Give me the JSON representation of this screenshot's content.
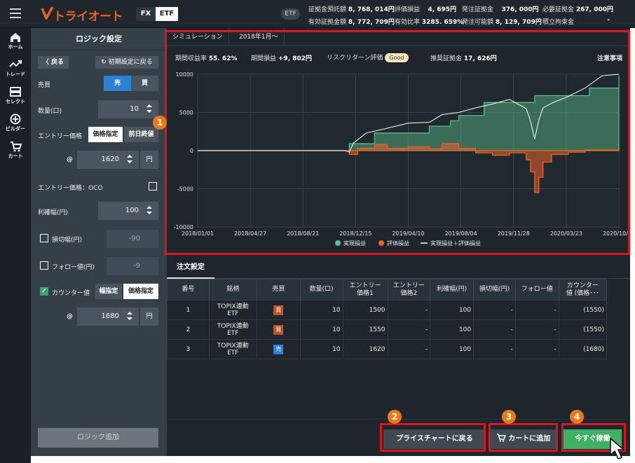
{
  "topbar": {
    "logo_text": "トライオート",
    "tabs": [
      {
        "label": "FX"
      },
      {
        "label": "ETF"
      }
    ],
    "etf_badge": "ETF",
    "stats": [
      {
        "label": "証拠金預託額",
        "value": "8, 768, 014円"
      },
      {
        "label": "評価損益",
        "value": "4, 695円"
      },
      {
        "label": "発注証拠金",
        "value": "376, 000円"
      },
      {
        "label": "必要証拠金",
        "value": "267, 000円"
      },
      {
        "label": "有効証拠金額",
        "value": "8, 772, 709円"
      },
      {
        "label": "有効比率",
        "value": "3285. 659%"
      },
      {
        "label": "発注可能額",
        "value": "8, 129, 709円"
      },
      {
        "label": "積立拘束金",
        "value": "-"
      }
    ]
  },
  "nav": [
    {
      "label": "ホーム",
      "icon": "home-icon"
    },
    {
      "label": "トレード",
      "icon": "trade-icon"
    },
    {
      "label": "セレクト",
      "icon": "select-icon"
    },
    {
      "label": "ビルダー",
      "icon": "builder-icon"
    },
    {
      "label": "カート",
      "icon": "cart-icon"
    }
  ],
  "logic": {
    "title": "ロジック設定",
    "back": "〈 戻る",
    "reset": "↻ 初期設定に戻る",
    "side_label": "売買",
    "side_sell": "売",
    "side_buy": "買",
    "qty_label": "数量(口)",
    "qty_value": "10",
    "entry_label": "エントリー価格",
    "entry_opt1": "価格指定",
    "entry_opt2": "前日終値",
    "at": "@",
    "entry_price": "1620",
    "yen": "円",
    "oco_label": "エントリー価格：OCO",
    "profit_label": "利確幅(円)",
    "profit_value": "100",
    "loss_label": "損切幅(円)",
    "loss_value": "-90",
    "follow_label": "フォロー値(円)",
    "follow_value": "-9",
    "counter_label": "カウンター値",
    "counter_opt1": "幅指定",
    "counter_opt2": "価格指定",
    "counter_price": "1680",
    "add_logic": "ロジック追加"
  },
  "simulation": {
    "tab": "シミュレーション",
    "period": "2018年1月～",
    "return_label": "期間収益率",
    "return_value": "55. 62%",
    "pnl_label": "期間損益",
    "pnl_value": "+9, 802円",
    "risk_label": "リスクリターン評価",
    "risk_value": "Good",
    "margin_label": "推奨証拠金",
    "margin_value": "17, 626円",
    "notes": "注意事項"
  },
  "chart_data": {
    "type": "area",
    "x_ticks": [
      "2018/01/01",
      "2018/04/27",
      "2018/08/21",
      "2018/12/15",
      "2019/04/10",
      "2019/08/04",
      "2019/11/28",
      "2020/03/23",
      "2020/10/01"
    ],
    "y_ticks": [
      "10000",
      "5000",
      "0",
      "-5000",
      "-10000"
    ],
    "ylim": [
      -10000,
      10000
    ],
    "legend": [
      "実現損益",
      "評価損益",
      "実現損益＋評価損益"
    ],
    "legend_colors": [
      "#5cbf87",
      "#e8632b",
      "#ffffff"
    ],
    "series": [
      {
        "name": "実現損益",
        "color": "#5cbf87",
        "points": [
          [
            0,
            0
          ],
          [
            0.28,
            0
          ],
          [
            0.35,
            0
          ],
          [
            0.36,
            900
          ],
          [
            0.42,
            2300
          ],
          [
            0.55,
            3200
          ],
          [
            0.6,
            3900
          ],
          [
            0.62,
            4600
          ],
          [
            0.68,
            6300
          ],
          [
            0.8,
            7200
          ],
          [
            0.9,
            7200
          ],
          [
            0.93,
            8200
          ],
          [
            1.0,
            9800
          ]
        ]
      },
      {
        "name": "評価損益",
        "color": "#e8632b",
        "points": [
          [
            0,
            0
          ],
          [
            0.35,
            0
          ],
          [
            0.36,
            -500
          ],
          [
            0.38,
            300
          ],
          [
            0.42,
            800
          ],
          [
            0.45,
            300
          ],
          [
            0.5,
            500
          ],
          [
            0.55,
            200
          ],
          [
            0.58,
            900
          ],
          [
            0.62,
            300
          ],
          [
            0.66,
            -300
          ],
          [
            0.7,
            -600
          ],
          [
            0.74,
            -300
          ],
          [
            0.78,
            -1200
          ],
          [
            0.79,
            -2800
          ],
          [
            0.8,
            -5500
          ],
          [
            0.81,
            -3500
          ],
          [
            0.82,
            -1500
          ],
          [
            0.84,
            -500
          ],
          [
            0.88,
            -200
          ],
          [
            0.92,
            100
          ],
          [
            1.0,
            0
          ]
        ]
      },
      {
        "name": "実現損益＋評価損益",
        "color": "#ffffff",
        "points": [
          [
            0,
            0
          ],
          [
            0.35,
            0
          ],
          [
            0.36,
            -200
          ],
          [
            0.37,
            1000
          ],
          [
            0.4,
            2300
          ],
          [
            0.44,
            2800
          ],
          [
            0.5,
            3600
          ],
          [
            0.55,
            3700
          ],
          [
            0.58,
            4700
          ],
          [
            0.62,
            5000
          ],
          [
            0.66,
            5600
          ],
          [
            0.7,
            6100
          ],
          [
            0.74,
            6700
          ],
          [
            0.78,
            5500
          ],
          [
            0.79,
            3900
          ],
          [
            0.8,
            1500
          ],
          [
            0.81,
            4000
          ],
          [
            0.82,
            5600
          ],
          [
            0.84,
            6200
          ],
          [
            0.88,
            7100
          ],
          [
            0.92,
            8200
          ],
          [
            0.96,
            9800
          ],
          [
            1.0,
            10000
          ]
        ]
      }
    ]
  },
  "orders": {
    "tab": "注文設定",
    "headers": [
      "番号",
      "銘柄",
      "売買",
      "数量(口)",
      "エントリー\n価格1",
      "エントリー\n価格2",
      "利確幅(円)",
      "損切幅(円)",
      "フォロー値",
      "カウンター\n値 (価格･･･"
    ],
    "rows": [
      {
        "no": "1",
        "symbol": "TOPIX連動\nETF",
        "side": "買",
        "side_type": "buy",
        "qty": "10",
        "entry1": "1500",
        "entry2": "-",
        "profit": "100",
        "loss": "-",
        "follow": "-",
        "counter": "(1550)"
      },
      {
        "no": "2",
        "symbol": "TOPIX連動\nETF",
        "side": "買",
        "side_type": "buy",
        "qty": "10",
        "entry1": "1550",
        "entry2": "-",
        "profit": "100",
        "loss": "-",
        "follow": "-",
        "counter": "(1550)"
      },
      {
        "no": "3",
        "symbol": "TOPIX連動\nETF",
        "side": "売",
        "side_type": "sell",
        "qty": "10",
        "entry1": "1620",
        "entry2": "-",
        "profit": "100",
        "loss": "-",
        "follow": "-",
        "counter": "(1680)"
      }
    ]
  },
  "actions": {
    "price_chart": "プライスチャートに戻る",
    "add_cart": "カートに追加",
    "order_now": "今すぐ稼働"
  },
  "markers": [
    "1",
    "2",
    "3",
    "4"
  ]
}
